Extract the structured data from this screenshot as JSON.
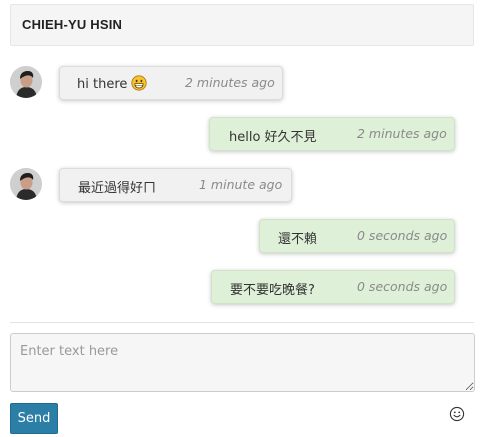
{
  "header": {
    "title": "CHIEH-YU HSIN"
  },
  "messages": [
    {
      "direction": "in",
      "text": "hi there",
      "emoji": "grinning-face-icon",
      "time": "2 minutes ago"
    },
    {
      "direction": "out",
      "text": "hello 好久不見",
      "time": "2 minutes ago"
    },
    {
      "direction": "in",
      "text": "最近過得好ㄇ",
      "time": "1 minute ago"
    },
    {
      "direction": "out",
      "text": "還不賴",
      "time": "0 seconds ago"
    },
    {
      "direction": "out",
      "text": "要不要吃晚餐?",
      "time": "0 seconds ago"
    }
  ],
  "composer": {
    "placeholder": "Enter text here",
    "value": "",
    "send_label": "Send",
    "emoji_button_icon": "smiley-icon"
  },
  "colors": {
    "incoming_bubble": "#f1f1f1",
    "outgoing_bubble": "#dff0d8",
    "send_button": "#2b7ea6",
    "timestamp": "#8a8a8a"
  }
}
